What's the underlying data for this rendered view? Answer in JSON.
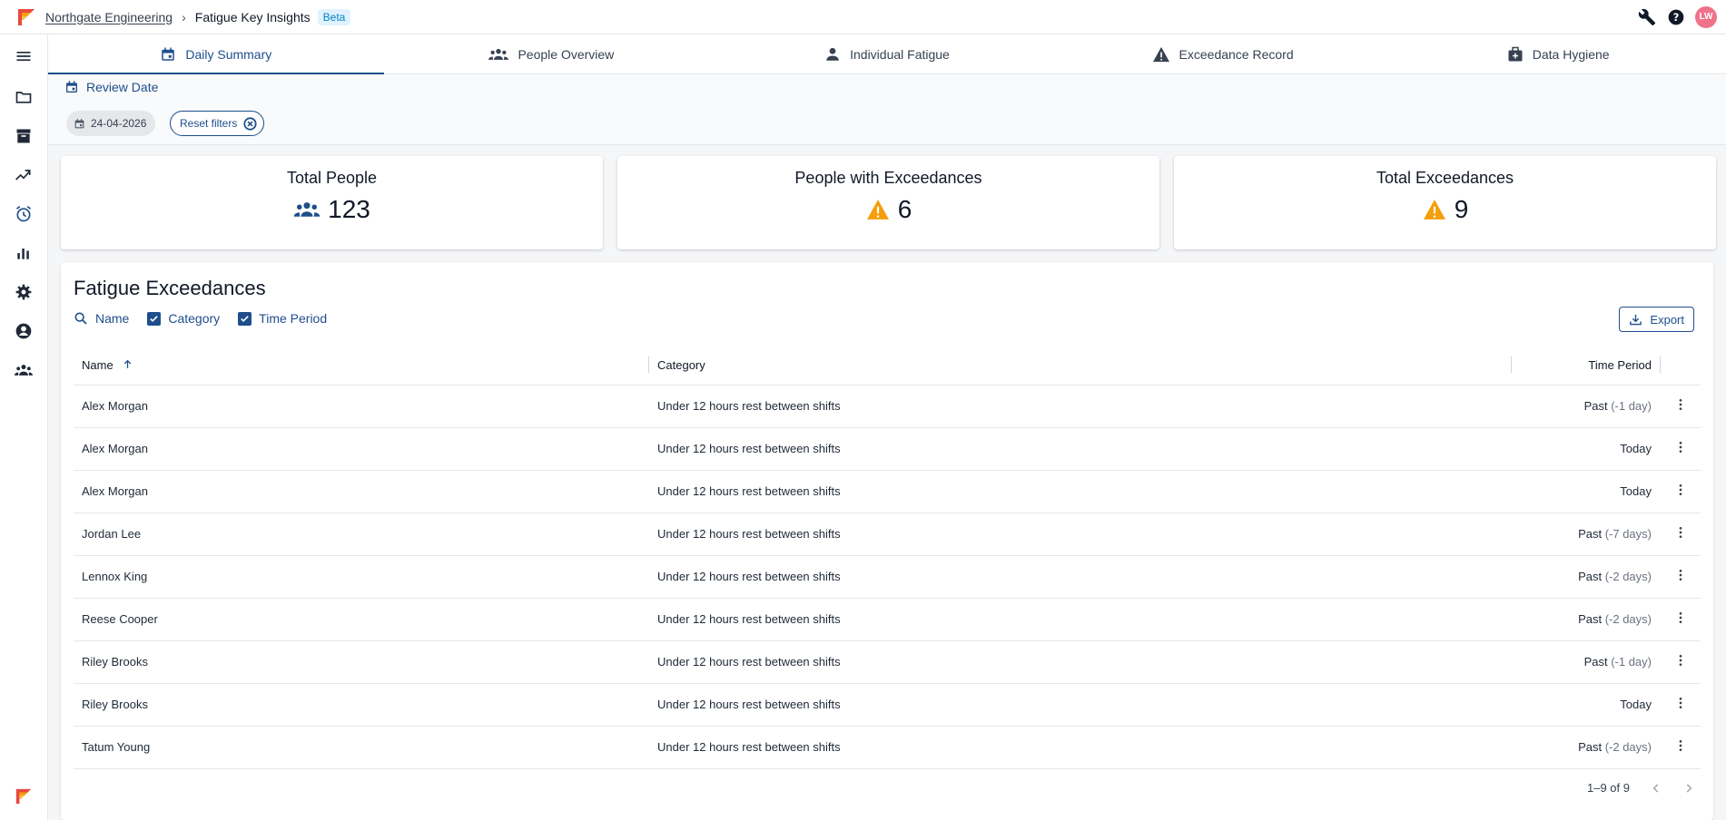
{
  "breadcrumb": {
    "org": "Northgate Engineering",
    "page": "Fatigue Key Insights",
    "badge": "Beta"
  },
  "header": {
    "avatar_initials": "LW"
  },
  "tabs": [
    {
      "label": "Daily Summary",
      "icon": "calendar-icon",
      "active": true
    },
    {
      "label": "People Overview",
      "icon": "people-icon",
      "active": false
    },
    {
      "label": "Individual Fatigue",
      "icon": "person-icon",
      "active": false
    },
    {
      "label": "Exceedance Record",
      "icon": "warning-icon",
      "active": false
    },
    {
      "label": "Data Hygiene",
      "icon": "medical-bag-icon",
      "active": false
    }
  ],
  "filters": {
    "review_label": "Review Date",
    "date_value": "24-04-2026",
    "reset_label": "Reset filters"
  },
  "stats": [
    {
      "title": "Total People",
      "value": "123",
      "icon": "people-icon"
    },
    {
      "title": "People with Exceedances",
      "value": "6",
      "icon": "warning-icon"
    },
    {
      "title": "Total Exceedances",
      "value": "9",
      "icon": "warning-icon"
    }
  ],
  "table": {
    "title": "Fatigue Exceedances",
    "column_filters": {
      "name": "Name",
      "category": "Category",
      "time_period": "Time Period"
    },
    "export_label": "Export",
    "columns": {
      "name": "Name",
      "category": "Category",
      "time_period": "Time Period"
    },
    "rows": [
      {
        "name": "Alex Morgan",
        "category": "Under 12 hours rest between shifts",
        "period": "Past",
        "offset": "(-1 day)"
      },
      {
        "name": "Alex Morgan",
        "category": "Under 12 hours rest between shifts",
        "period": "Today",
        "offset": ""
      },
      {
        "name": "Alex Morgan",
        "category": "Under 12 hours rest between shifts",
        "period": "Today",
        "offset": ""
      },
      {
        "name": "Jordan Lee",
        "category": "Under 12 hours rest between shifts",
        "period": "Past",
        "offset": "(-7 days)"
      },
      {
        "name": "Lennox King",
        "category": "Under 12 hours rest between shifts",
        "period": "Past",
        "offset": "(-2 days)"
      },
      {
        "name": "Reese Cooper",
        "category": "Under 12 hours rest between shifts",
        "period": "Past",
        "offset": "(-2 days)"
      },
      {
        "name": "Riley Brooks",
        "category": "Under 12 hours rest between shifts",
        "period": "Past",
        "offset": "(-1 day)"
      },
      {
        "name": "Riley Brooks",
        "category": "Under 12 hours rest between shifts",
        "period": "Today",
        "offset": ""
      },
      {
        "name": "Tatum Young",
        "category": "Under 12 hours rest between shifts",
        "period": "Past",
        "offset": "(-2 days)"
      }
    ],
    "pagination": "1–9 of 9"
  },
  "colors": {
    "primary": "#1e4e8c",
    "warning": "#f59e0b",
    "avatar": "#f0718a",
    "beta": "#0284c7"
  }
}
